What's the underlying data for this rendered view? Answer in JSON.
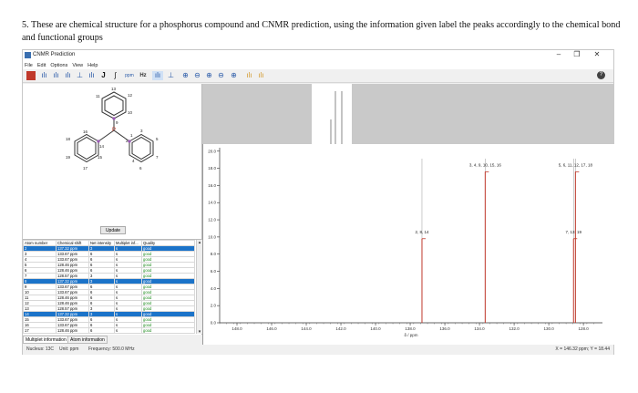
{
  "question": "5.  These are chemical structure for a phosphorus compound and CNMR prediction, using the information given label the peaks accordingly to the chemical bond and functional groups",
  "window": {
    "title": "CNMR Prediction",
    "minimize": "–",
    "maximize": "❐",
    "close": "✕"
  },
  "menu": [
    "File",
    "Edit",
    "Options",
    "View",
    "Help"
  ],
  "toolbar": {
    "ppm_label": "ppm",
    "hz_label": "Hz",
    "j_label": "J",
    "help_label": "?"
  },
  "structure": {
    "atom_labels": {
      "p": "P",
      "a1": "1",
      "a2": "2",
      "a3": "3",
      "a4": "4",
      "a5": "5",
      "a6": "6",
      "a7": "7",
      "a9": "9",
      "a10": "10",
      "a11": "11",
      "a12": "12",
      "a13": "13",
      "a14": "14",
      "a15": "15",
      "a16": "16",
      "a17": "17",
      "a18": "18",
      "a19": "19"
    },
    "update_label": "Update"
  },
  "table": {
    "headers": [
      "Atom number",
      "Chemical shift",
      "Net intensity",
      "Multiplet inf...",
      "Quality"
    ],
    "rows": [
      {
        "atom": "2",
        "shift": "137.32 ppm",
        "intensity": "3",
        "mult": "s",
        "quality": "good",
        "selected": true
      },
      {
        "atom": "3",
        "shift": "133.67 ppm",
        "intensity": "6",
        "mult": "s",
        "quality": "good",
        "selected": false
      },
      {
        "atom": "4",
        "shift": "133.67 ppm",
        "intensity": "6",
        "mult": "s",
        "quality": "good",
        "selected": false
      },
      {
        "atom": "5",
        "shift": "128.46 ppm",
        "intensity": "6",
        "mult": "s",
        "quality": "good",
        "selected": false
      },
      {
        "atom": "6",
        "shift": "128.46 ppm",
        "intensity": "6",
        "mult": "s",
        "quality": "good",
        "selected": false
      },
      {
        "atom": "7",
        "shift": "128.57 ppm",
        "intensity": "3",
        "mult": "s",
        "quality": "good",
        "selected": false
      },
      {
        "atom": "8",
        "shift": "137.32 ppm",
        "intensity": "3",
        "mult": "s",
        "quality": "good",
        "selected": true
      },
      {
        "atom": "9",
        "shift": "133.67 ppm",
        "intensity": "6",
        "mult": "s",
        "quality": "good",
        "selected": false
      },
      {
        "atom": "10",
        "shift": "133.67 ppm",
        "intensity": "6",
        "mult": "s",
        "quality": "good",
        "selected": false
      },
      {
        "atom": "11",
        "shift": "128.46 ppm",
        "intensity": "6",
        "mult": "s",
        "quality": "good",
        "selected": false
      },
      {
        "atom": "12",
        "shift": "128.46 ppm",
        "intensity": "6",
        "mult": "s",
        "quality": "good",
        "selected": false
      },
      {
        "atom": "13",
        "shift": "128.57 ppm",
        "intensity": "3",
        "mult": "s",
        "quality": "good",
        "selected": false
      },
      {
        "atom": "14",
        "shift": "137.32 ppm",
        "intensity": "3",
        "mult": "s",
        "quality": "good",
        "selected": true
      },
      {
        "atom": "15",
        "shift": "133.67 ppm",
        "intensity": "6",
        "mult": "s",
        "quality": "good",
        "selected": false
      },
      {
        "atom": "16",
        "shift": "133.67 ppm",
        "intensity": "6",
        "mult": "s",
        "quality": "good",
        "selected": false
      },
      {
        "atom": "17",
        "shift": "128.46 ppm",
        "intensity": "6",
        "mult": "s",
        "quality": "good",
        "selected": false
      },
      {
        "atom": "18",
        "shift": "128.46 ppm",
        "intensity": "6",
        "mult": "s",
        "quality": "good",
        "selected": false
      }
    ]
  },
  "tabs": [
    "Multiplet information",
    "Atom information"
  ],
  "status": {
    "nucleus": "Nucleus: 13C",
    "unit": "Unit: ppm",
    "frequency": "Frequency: 500.0 MHz",
    "cursor": "X = 146.32 ppm; Y = 18.44"
  },
  "chart_data": {
    "type": "line",
    "xlabel": "δ / ppm",
    "x_ticks": [
      "148.0",
      "146.0",
      "144.0",
      "142.0",
      "140.0",
      "138.0",
      "136.0",
      "134.0",
      "132.0",
      "130.0",
      "128.0"
    ],
    "y_ticks": [
      "0.0",
      "2.0",
      "4.0",
      "6.0",
      "8.0",
      "10.0",
      "12.0",
      "14.0",
      "16.0",
      "18.0",
      "20.0"
    ],
    "xlim": [
      149.0,
      126.9
    ],
    "ylim": [
      0,
      20.4
    ],
    "peaks": [
      {
        "x": 137.32,
        "y": 9.8,
        "label": "2, 8, 14"
      },
      {
        "x": 133.67,
        "y": 17.6,
        "label": "3, 4, 9, 10, 15, 16"
      },
      {
        "x": 128.57,
        "y": 9.8,
        "label": "7, 13, 19"
      },
      {
        "x": 128.46,
        "y": 17.6,
        "label": "5, 6, 11, 12, 17, 18"
      }
    ],
    "colors": {
      "peak": "#c0392b",
      "accent": "#1b73c9"
    }
  }
}
